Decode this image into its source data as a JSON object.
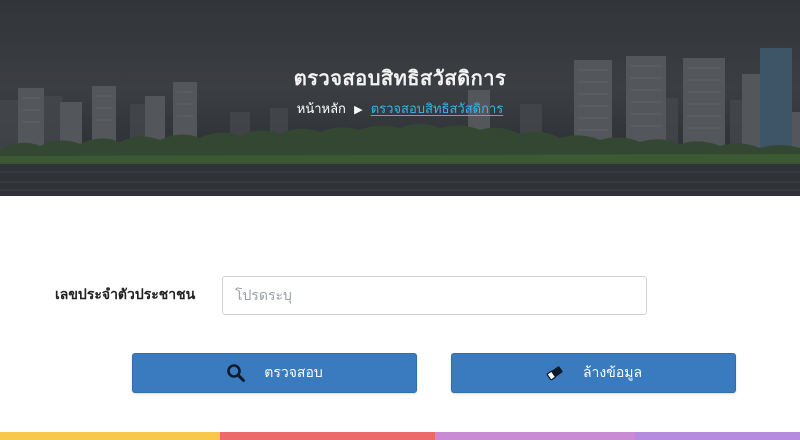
{
  "hero": {
    "title": "ตรวจสอบสิทธิสวัสดิการ",
    "breadcrumb": {
      "home": "หน้าหลัก",
      "separator": "▶",
      "current": "ตรวจสอบสิทธิสวัสดิการ"
    }
  },
  "form": {
    "id_label": "เลขประจำตัวประชาชน",
    "id_value": "",
    "id_placeholder": "โปรดระบุ"
  },
  "buttons": {
    "check": {
      "label": "ตรวจสอบ",
      "icon": "search-icon"
    },
    "clear": {
      "label": "ล้างข้อมูล",
      "icon": "eraser-icon"
    }
  },
  "colors": {
    "button_primary": "#3a7abf",
    "breadcrumb_current": "#3bb3e6",
    "stripe": [
      "#f7c84a",
      "#ec6a6a",
      "#c98bd3",
      "#b58be0"
    ]
  }
}
